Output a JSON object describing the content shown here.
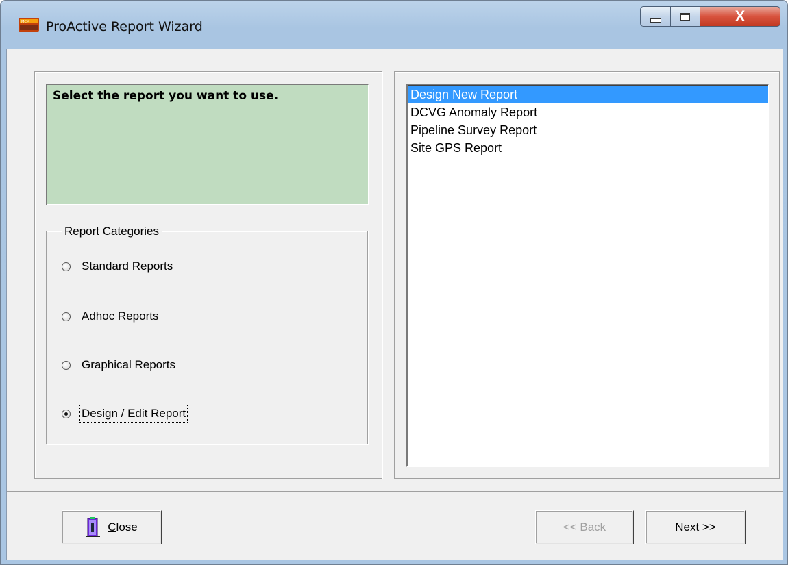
{
  "window": {
    "title": "ProActive Report Wizard",
    "icon": "app-report-icon",
    "close_glyph": "X"
  },
  "prompt": {
    "text": "Select the report you want to use."
  },
  "categories": {
    "legend": "Report Categories",
    "options": [
      {
        "label": "Standard Reports",
        "checked": false
      },
      {
        "label": "Adhoc Reports",
        "checked": false
      },
      {
        "label": "Graphical Reports",
        "checked": false
      },
      {
        "label": "Design / Edit Report",
        "checked": true
      }
    ]
  },
  "reports": {
    "items": [
      {
        "label": "Design New Report",
        "selected": true
      },
      {
        "label": "DCVG Anomaly Report",
        "selected": false
      },
      {
        "label": "Pipeline Survey Report",
        "selected": false
      },
      {
        "label": "Site GPS Report",
        "selected": false
      }
    ]
  },
  "buttons": {
    "close_label": "Close",
    "close_icon": "door-exit-icon",
    "back_label": "<< Back",
    "back_enabled": false,
    "next_label": "Next >>"
  },
  "colors": {
    "prompt_background": "#c0dcc0",
    "selection": "#3399ff",
    "close_button": "#c23a22"
  }
}
